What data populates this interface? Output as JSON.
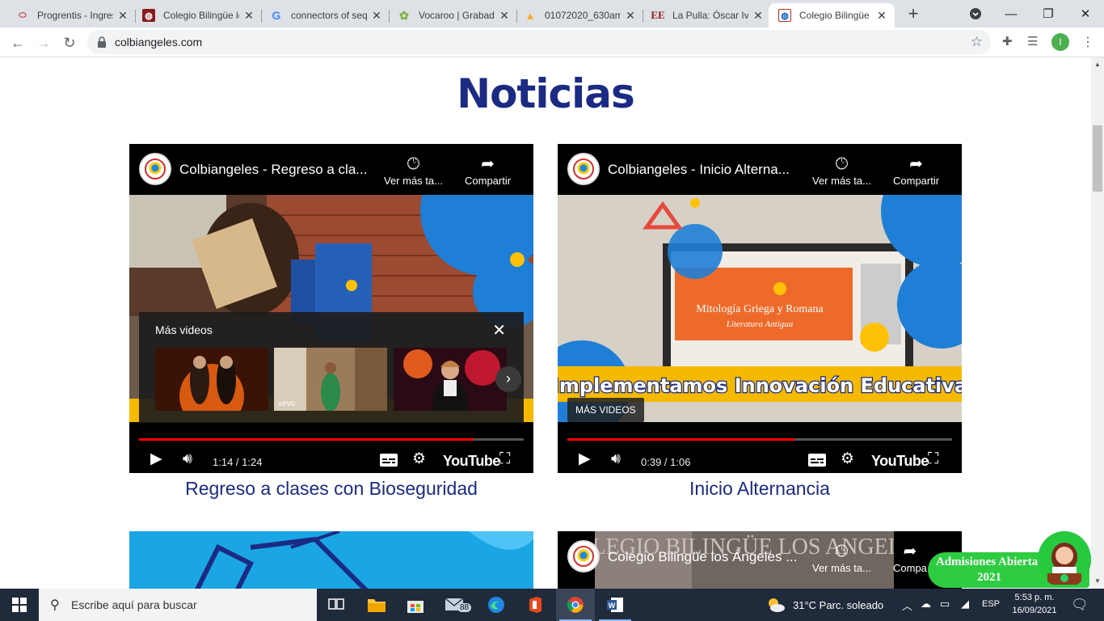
{
  "browser": {
    "tabs": [
      {
        "title": "Progrentis - Ingreso",
        "favicon": "progrentis-icon"
      },
      {
        "title": "Colegio Bilingüe los Ángeles",
        "favicon": "colegio-icon"
      },
      {
        "title": "connectors of sequence",
        "favicon": "google-icon"
      },
      {
        "title": "Vocaroo | Grabador",
        "favicon": "vocaroo-icon"
      },
      {
        "title": "01072020_630am",
        "favicon": "file-icon"
      },
      {
        "title": "La Pulla: Óscar Iván",
        "favicon": "elespectador-icon"
      },
      {
        "title": "Colegio Bilingüe",
        "favicon": "colegio-icon",
        "active": true
      }
    ],
    "url": "colbiangeles.com",
    "profile_initial": "I"
  },
  "page": {
    "heading": "Noticias",
    "videos": [
      {
        "title": "Colbiangeles - Regreso a cla...",
        "watch_later": "Ver más ta...",
        "share": "Compartir",
        "time": "1:14 / 1:24",
        "played_pct": 87,
        "caption": "Regreso a clases con Bioseguridad",
        "more_videos_title": "Más videos",
        "youtube": "YouTube"
      },
      {
        "title": "Colbiangeles - Inicio Alterna...",
        "watch_later": "Ver más ta...",
        "share": "Compartir",
        "time": "0:39 / 1:06",
        "played_pct": 59,
        "caption": "Inicio Alternancia",
        "banner": "Implementamos Innovación Educativa",
        "slide_title": "Mitología Griega y Romana",
        "slide_sub": "Literatura Antigua",
        "more_videos_btn": "MÁS VIDEOS",
        "youtube": "YouTube"
      },
      {
        "title": "Colegio Bilingüe los Ángeles ...",
        "watch_later": "Ver más ta...",
        "share": "Compa",
        "bg_text": "COLEGIO BILINGÜE LOS ANGELES"
      }
    ],
    "admissions": {
      "line1": "Admisiones Abiertas",
      "line2": "2021"
    }
  },
  "taskbar": {
    "search_placeholder": "Escribe aquí para buscar",
    "mail_badge": "88",
    "weather": "31°C  Parc. soleado",
    "lang": "ESP",
    "time": "5:53 p. m.",
    "date": "16/09/2021"
  }
}
